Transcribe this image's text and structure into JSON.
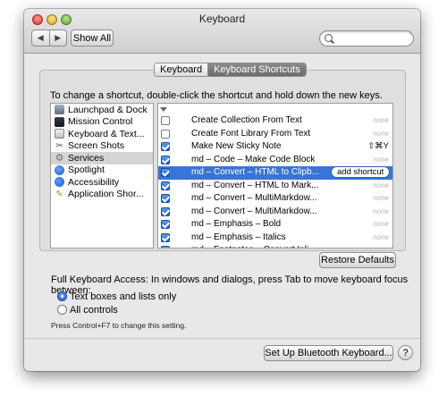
{
  "window": {
    "title": "Keyboard"
  },
  "toolbar": {
    "back_icon": "chevron-left-icon",
    "forward_icon": "chevron-right-icon",
    "back_glyph": "◀",
    "forward_glyph": "▶",
    "show_all_label": "Show All",
    "search_placeholder": ""
  },
  "tabs": [
    {
      "label": "Keyboard",
      "active": false
    },
    {
      "label": "Keyboard Shortcuts",
      "active": true
    }
  ],
  "instruction": "To change a shortcut, double-click the shortcut and hold down the new keys.",
  "categories": [
    {
      "label": "Launchpad & Dock",
      "icon": "launchpad-icon",
      "glyph": "",
      "selected": false
    },
    {
      "label": "Mission Control",
      "icon": "mission-control-icon",
      "glyph": "",
      "selected": false
    },
    {
      "label": "Keyboard & Text...",
      "icon": "keyboard-icon",
      "glyph": "",
      "selected": false
    },
    {
      "label": "Screen Shots",
      "icon": "screenshot-icon",
      "glyph": "✂",
      "selected": false
    },
    {
      "label": "Services",
      "icon": "gear-icon",
      "glyph": "⚙",
      "selected": true
    },
    {
      "label": "Spotlight",
      "icon": "spotlight-icon",
      "glyph": "",
      "selected": false
    },
    {
      "label": "Accessibility",
      "icon": "accessibility-icon",
      "glyph": "",
      "selected": false
    },
    {
      "label": "Application Shor...",
      "icon": "app-shortcuts-icon",
      "glyph": "✎",
      "selected": false
    }
  ],
  "shortcuts": [
    {
      "name": "Create Collection From Text",
      "checked": false,
      "key": "none",
      "key_set": false,
      "selected": false
    },
    {
      "name": "Create Font Library From Text",
      "checked": false,
      "key": "none",
      "key_set": false,
      "selected": false
    },
    {
      "name": "Make New Sticky Note",
      "checked": true,
      "key": "⇧⌘Y",
      "key_set": true,
      "selected": false
    },
    {
      "name": "md – Code – Make Code Block",
      "checked": true,
      "key": "none",
      "key_set": false,
      "selected": false
    },
    {
      "name": "md – Convert – HTML to Clipb...",
      "checked": true,
      "key": "",
      "key_set": false,
      "selected": true
    },
    {
      "name": "md – Convert – HTML to Mark...",
      "checked": true,
      "key": "none",
      "key_set": false,
      "selected": false
    },
    {
      "name": "md – Convert – MultiMarkdow...",
      "checked": true,
      "key": "none",
      "key_set": false,
      "selected": false
    },
    {
      "name": "md – Convert – MultiMarkdow...",
      "checked": true,
      "key": "none",
      "key_set": false,
      "selected": false
    },
    {
      "name": "md – Emphasis – Bold",
      "checked": true,
      "key": "none",
      "key_set": false,
      "selected": false
    },
    {
      "name": "md – Emphasis – Italics",
      "checked": true,
      "key": "none",
      "key_set": false,
      "selected": false
    },
    {
      "name": "md – Footnotes – Convert Inli...",
      "checked": true,
      "key": "none",
      "key_set": false,
      "selected": false
    }
  ],
  "add_shortcut_label": "add shortcut",
  "restore_defaults_label": "Restore Defaults",
  "full_keyboard_access": {
    "label": "Full Keyboard Access: In windows and dialogs, press Tab to move keyboard focus between:",
    "options": [
      {
        "label": "Text boxes and lists only",
        "selected": true
      },
      {
        "label": "All controls",
        "selected": false
      }
    ],
    "hint": "Press Control+F7 to change this setting."
  },
  "bluetooth_label": "Set Up Bluetooth Keyboard...",
  "help_label": "?",
  "colors": {
    "selection": "#3875d7",
    "accent": "#1f5fd3"
  }
}
